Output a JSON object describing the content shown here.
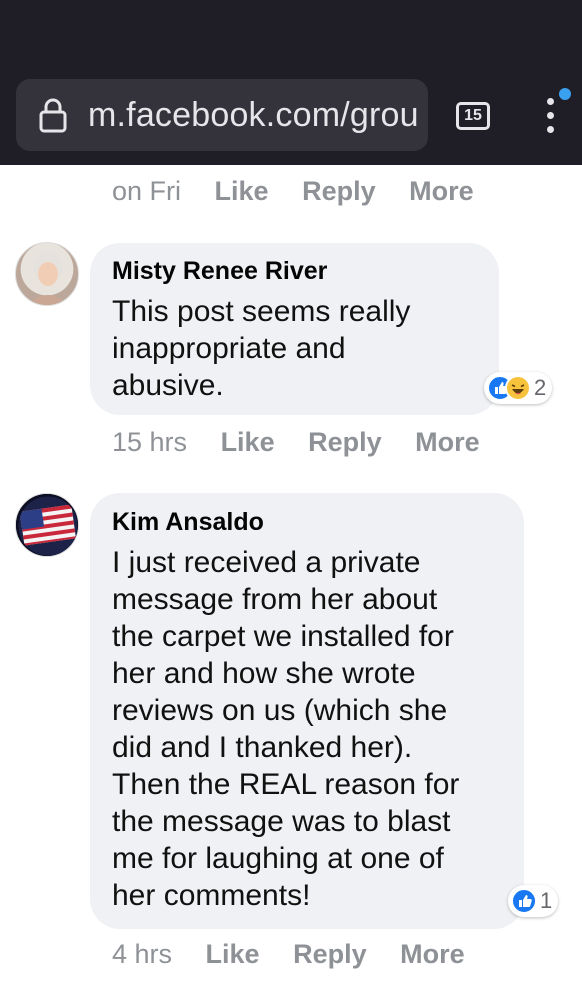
{
  "browser": {
    "url": "m.facebook.com/grou",
    "tab_count": "15"
  },
  "top_action_row": {
    "time": "on Fri",
    "like": "Like",
    "reply": "Reply",
    "more": "More"
  },
  "comments": [
    {
      "author": "Misty Renee River",
      "text": "This post seems really\ninappropriate and\nabusive.",
      "reaction_count": "2",
      "time": "15 hrs",
      "like": "Like",
      "reply": "Reply",
      "more": "More"
    },
    {
      "author": "Kim Ansaldo",
      "text": "I just received a private\nmessage from her about\nthe carpet we installed for\nher and how she wrote\nreviews on us (which she\ndid and I thanked her).\nThen the REAL reason for\nthe message was to blast\nme for laughing at one of\nher comments!",
      "reaction_count": "1",
      "time": "4 hrs",
      "like": "Like",
      "reply": "Reply",
      "more": "More"
    }
  ],
  "colors": {
    "chrome_bg": "#1f1e26",
    "urlbar_bg": "#34333b",
    "bubble_bg": "#eff1f4",
    "like_blue": "#1877f2",
    "action_gray": "#8e9196"
  }
}
